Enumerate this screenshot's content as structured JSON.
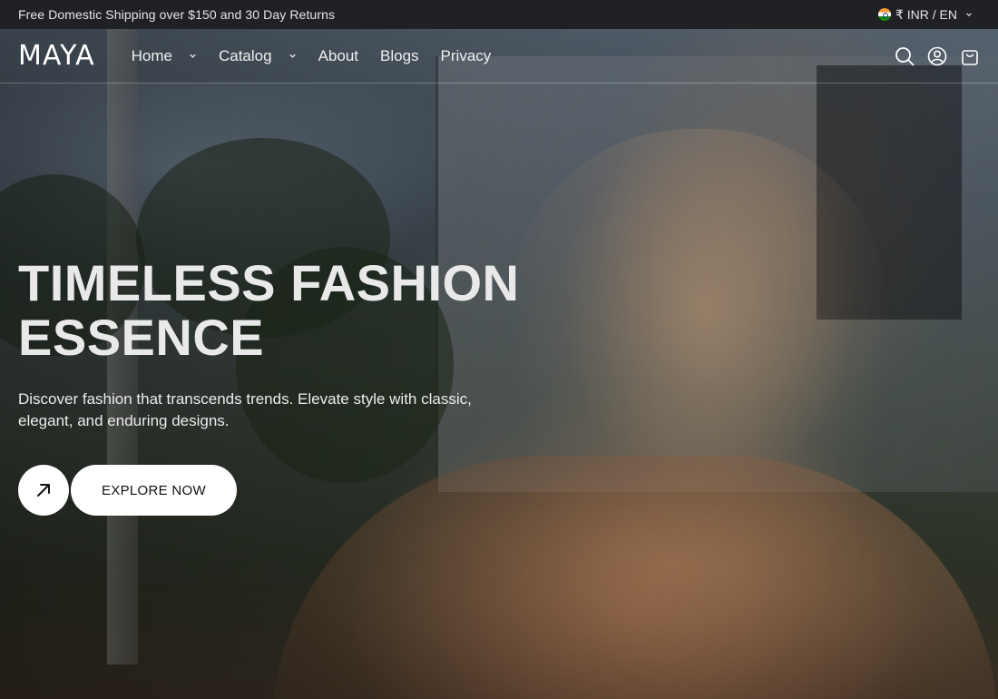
{
  "announcement": {
    "text": "Free Domestic Shipping over $150 and 30 Day Returns"
  },
  "locale": {
    "label": "₹ INR / EN",
    "flag_icon": "india-flag-icon"
  },
  "header": {
    "logo": "MAYA",
    "nav": [
      {
        "label": "Home",
        "has_dropdown": true
      },
      {
        "label": "Catalog",
        "has_dropdown": true
      },
      {
        "label": "About",
        "has_dropdown": false
      },
      {
        "label": "Blogs",
        "has_dropdown": false
      },
      {
        "label": "Privacy",
        "has_dropdown": false
      }
    ],
    "icons": [
      "search-icon",
      "account-icon",
      "cart-icon"
    ]
  },
  "hero": {
    "title_line1": "TIMELESS FASHION",
    "title_line2": "ESSENCE",
    "subtitle": "Discover fashion that transcends trends. Elevate style with classic, elegant, and enduring designs.",
    "cta_label": "EXPLORE NOW"
  },
  "colors": {
    "announcement_bg": "#202124",
    "button_bg": "#ffffff",
    "button_text": "#111111"
  }
}
